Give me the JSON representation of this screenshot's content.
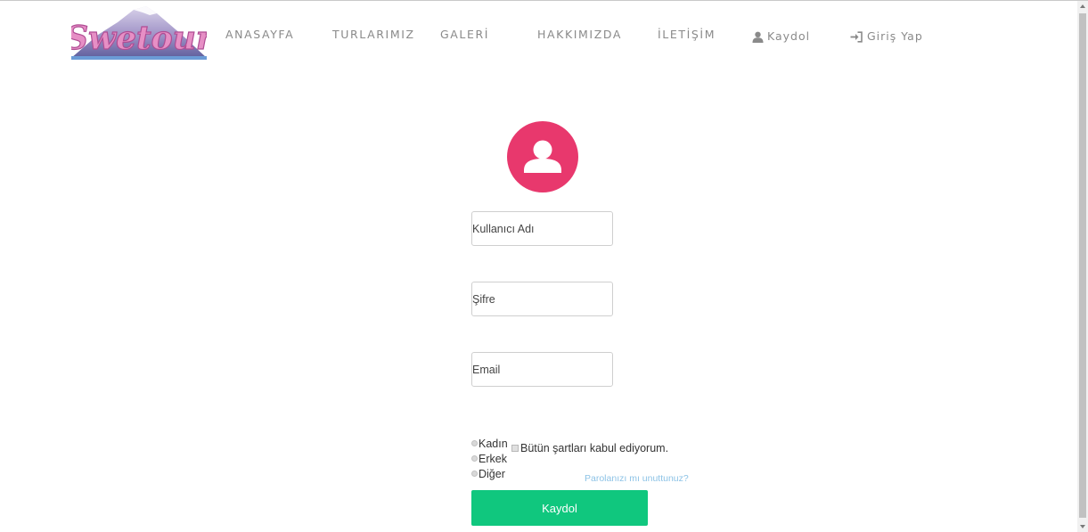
{
  "brand": {
    "logo_text": "Swetour"
  },
  "nav": {
    "items": [
      {
        "label": "ANASAYFA"
      },
      {
        "label": "TURLARIMIZ"
      },
      {
        "label": "GALERİ"
      },
      {
        "label": "HAKKIMIZDA"
      },
      {
        "label": "İLETİŞİM"
      }
    ],
    "register": {
      "label": "Kaydol",
      "icon": "user-icon"
    },
    "login": {
      "label": "Giriş Yap",
      "icon": "sign-in-icon"
    }
  },
  "form": {
    "avatar_icon": "user-avatar-icon",
    "username": {
      "placeholder": "Kullanıcı Adı",
      "value": ""
    },
    "password": {
      "placeholder": "Şifre",
      "value": ""
    },
    "email": {
      "placeholder": "Email",
      "value": ""
    },
    "gender_options": [
      {
        "label": "Kadın"
      },
      {
        "label": "Erkek"
      },
      {
        "label": "Diğer"
      }
    ],
    "terms_label": "Bütün şartları kabul ediyorum.",
    "forgot_password": "Parolanızı mı unuttunuz?",
    "submit_label": "Kaydol"
  },
  "colors": {
    "accent_avatar": "#e8386d",
    "submit": "#10c77e",
    "link": "#8dc3e6",
    "nav_text": "#8a8a8a"
  }
}
